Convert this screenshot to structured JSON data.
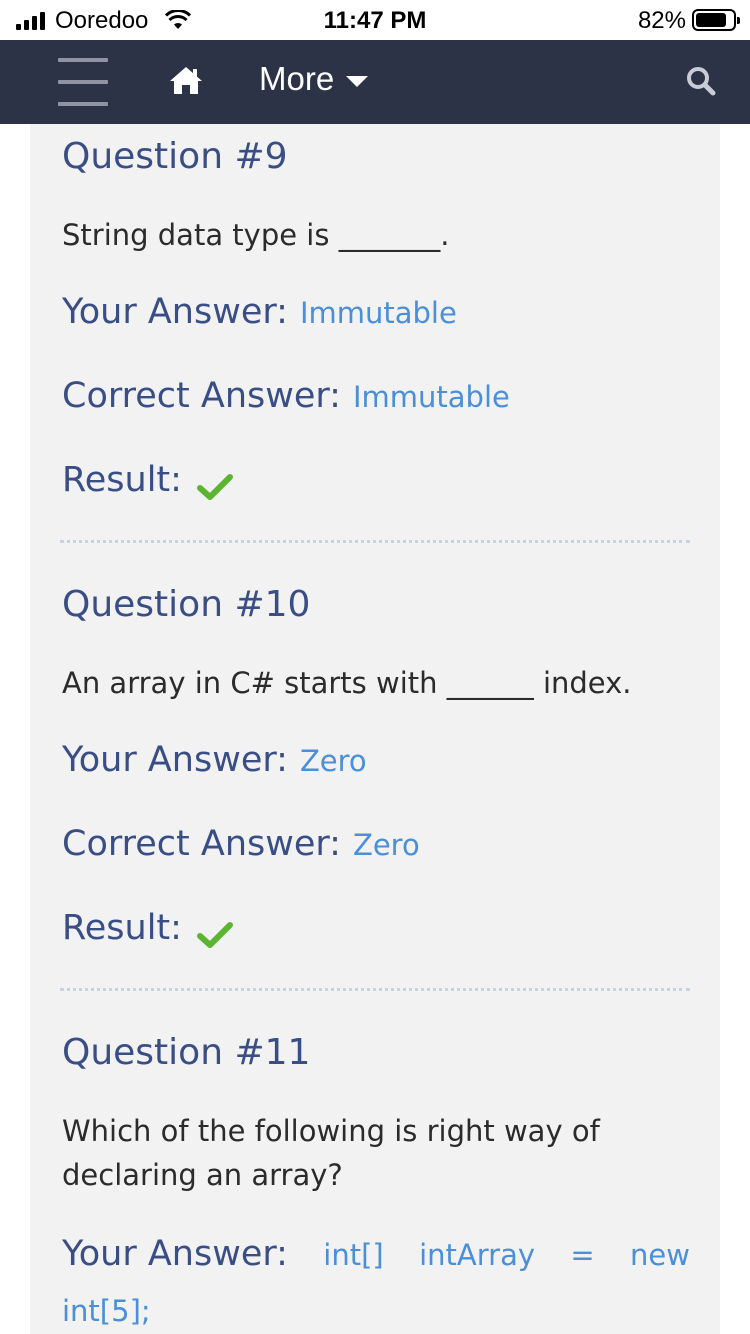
{
  "status_bar": {
    "carrier": "Ooredoo",
    "time": "11:47 PM",
    "battery_percent": "82%",
    "battery_level": 0.82
  },
  "navbar": {
    "menu_icon": "hamburger-icon",
    "home_icon": "home-icon",
    "more_label": "More",
    "search_icon": "search-icon",
    "background_color": "#2c3347"
  },
  "questions": [
    {
      "title": "Question #9",
      "text": "String data type is _______.",
      "your_answer_label": "Your Answer:",
      "your_answer": "Immutable",
      "correct_answer_label": "Correct Answer:",
      "correct_answer": "Immutable",
      "result_label": "Result:",
      "result_icon": "check-icon"
    },
    {
      "title": "Question #10",
      "text": "An array in C# starts with ______ index.",
      "your_answer_label": "Your Answer:",
      "your_answer": "Zero",
      "correct_answer_label": "Correct Answer:",
      "correct_answer": "Zero",
      "result_label": "Result:",
      "result_icon": "check-icon"
    },
    {
      "title": "Question #11",
      "text": "Which of the following is right way of declaring an array?",
      "your_answer_label": "Your Answer:",
      "your_answer_line1": [
        "int[]",
        "intArray",
        "=",
        "new"
      ],
      "your_answer_line2": "int[5];"
    }
  ],
  "colors": {
    "heading": "#3a4e86",
    "answer": "#4a8fd8",
    "correct": "#5cb531"
  }
}
